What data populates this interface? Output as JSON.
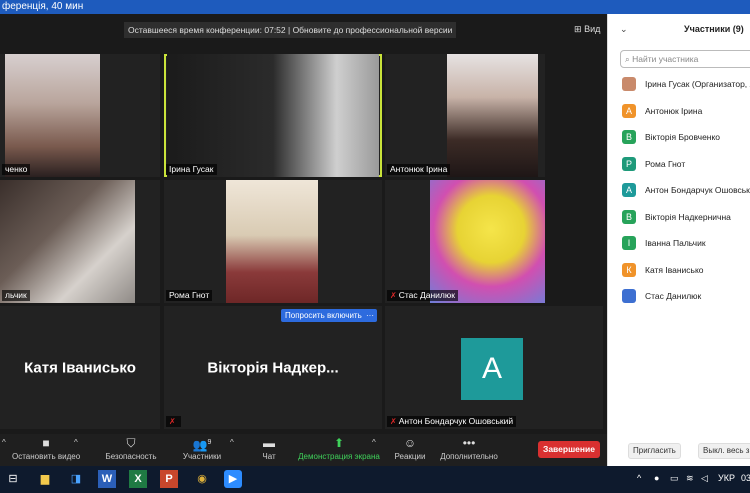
{
  "window": {
    "title": "ференція, 40 мин"
  },
  "meeting": {
    "banner": "Оставшееся время конференции: 07:52 | Обновите до профессиональной версии",
    "view_label": "Вид",
    "ask_enable_label": "Попросить включить",
    "more_label": "···",
    "avatar_letter": "A",
    "tiles": [
      {
        "name": "ченко"
      },
      {
        "name": "Ірина Гусак"
      },
      {
        "name": "Антонюк Ірина"
      },
      {
        "name": "льчик"
      },
      {
        "name": "Рома Гнот"
      },
      {
        "name": "Стас Данилюк"
      },
      {
        "big_name": "Катя Іванисько"
      },
      {
        "big_name": "Вікторія Надкер..."
      },
      {
        "name": "Антон Бондарчук Ошовський"
      }
    ]
  },
  "toolbar": {
    "video": "Остановить видео",
    "security": "Безопасность",
    "participants": "Участники",
    "participants_count": "9",
    "chat": "Чат",
    "share": "Демонстрация экрана",
    "reactions": "Реакции",
    "more": "Дополнительно",
    "end": "Завершение"
  },
  "panel": {
    "title": "Участники (9)",
    "search_placeholder": "Найти участника",
    "participants": [
      {
        "initial": "",
        "name": "Ірина Гусак (Организатор, я",
        "color": "#c98a6b"
      },
      {
        "initial": "А",
        "name": "Антонюк Ірина",
        "color": "#f0932a"
      },
      {
        "initial": "В",
        "name": "Вікторія Бровченко",
        "color": "#27a35a"
      },
      {
        "initial": "Р",
        "name": "Рома Гнот",
        "color": "#1e9a7a"
      },
      {
        "initial": "А",
        "name": "Антон Бондарчук Ошовськ",
        "color": "#1e9a9a"
      },
      {
        "initial": "В",
        "name": "Вікторія Надкерничнa",
        "color": "#27a35a"
      },
      {
        "initial": "І",
        "name": "Іванна Пальчик",
        "color": "#27a35a"
      },
      {
        "initial": "К",
        "name": "Катя Іванисько",
        "color": "#f0932a"
      },
      {
        "initial": "",
        "name": "Стас Данилюк",
        "color": "#3d6fd1"
      }
    ],
    "invite": "Пригласить",
    "mute_all": "Выкл. весь зв"
  },
  "taskbar": {
    "lang": "УКР",
    "time": "03"
  }
}
